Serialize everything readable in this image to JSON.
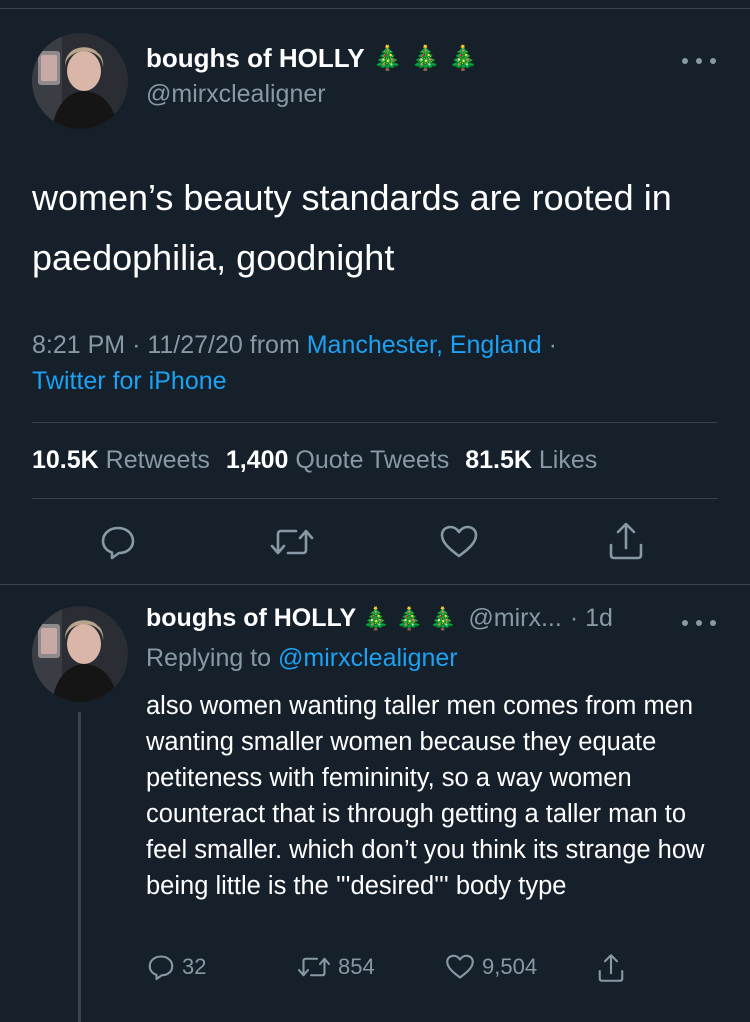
{
  "main_tweet": {
    "display_name": "boughs of HOLLY",
    "emoji": [
      "🎄",
      "🎄",
      "🎄"
    ],
    "handle": "@mirxclealigner",
    "text": "women’s beauty standards are rooted in paedophilia, goodnight",
    "time": "8:21 PM",
    "date": "11/27/20",
    "from_label": "from",
    "location": "Manchester, England",
    "client": "Twitter for iPhone",
    "separator": "·",
    "stats": {
      "retweets_count": "10.5K",
      "retweets_label": "Retweets",
      "quotes_count": "1,400",
      "quotes_label": "Quote Tweets",
      "likes_count": "81.5K",
      "likes_label": "Likes"
    },
    "actions": [
      "reply-icon",
      "retweet-icon",
      "heart-icon",
      "share-icon"
    ]
  },
  "reply_tweet": {
    "display_name": "boughs of HOLLY",
    "emoji": [
      "🎄",
      "🎄",
      "🎄"
    ],
    "handle_short": "@mirx...",
    "age": "· 1d",
    "replying_to_label": "Replying to",
    "replying_to_handle": "@mirxclealigner",
    "text": "also women wanting taller men comes from men wanting smaller women because they equate petiteness with femininity, so a way women counteract that is through getting a taller man to feel smaller. which don’t you think its strange how being little is the '''desired''' body type",
    "counts": {
      "replies": "32",
      "retweets": "854",
      "likes": "9,504"
    }
  },
  "colors": {
    "background": "#15202b",
    "text": "#ffffff",
    "secondary": "#8899a6",
    "link": "#1da1f2",
    "divider": "#38444d"
  }
}
